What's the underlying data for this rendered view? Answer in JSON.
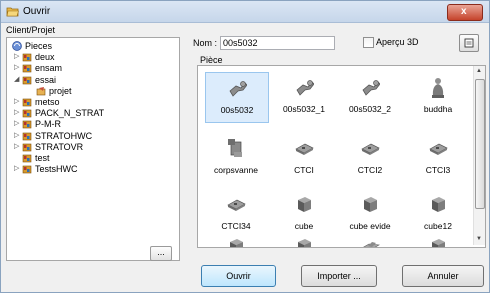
{
  "window": {
    "title": "Ouvrir",
    "close_label": "x"
  },
  "left_panel": {
    "label": "Client/Projet",
    "tree": [
      {
        "label": "Pieces",
        "icon": "pieces-icon",
        "expander": "",
        "level": 0
      },
      {
        "label": "deux",
        "icon": "folder-icon",
        "expander": "▷",
        "level": 1
      },
      {
        "label": "ensam",
        "icon": "folder-icon",
        "expander": "▷",
        "level": 1
      },
      {
        "label": "essai",
        "icon": "folder-icon",
        "expander": "◢",
        "level": 1
      },
      {
        "label": "projet",
        "icon": "project-icon",
        "expander": "",
        "level": 2
      },
      {
        "label": "metso",
        "icon": "folder-icon",
        "expander": "▷",
        "level": 1
      },
      {
        "label": "PACK_N_STRAT",
        "icon": "folder-icon",
        "expander": "▷",
        "level": 1
      },
      {
        "label": "P-M-R",
        "icon": "folder-icon",
        "expander": "▷",
        "level": 1
      },
      {
        "label": "STRATOHWC",
        "icon": "folder-icon",
        "expander": "▷",
        "level": 1
      },
      {
        "label": "STRATOVR",
        "icon": "folder-icon",
        "expander": "▷",
        "level": 1
      },
      {
        "label": "test",
        "icon": "folder-icon",
        "expander": "",
        "level": 1
      },
      {
        "label": "TestsHWC",
        "icon": "folder-icon",
        "expander": "▷",
        "level": 1
      }
    ],
    "browse_button": "..."
  },
  "right_panel": {
    "name_label": "Nom :",
    "name_value": "00s5032",
    "preview3d_label": "Aperçu 3D",
    "pieces_label": "Pièce",
    "items": [
      {
        "label": "00s5032",
        "icon": "valve-icon",
        "selected": true
      },
      {
        "label": "00s5032_1",
        "icon": "valve-icon",
        "selected": false
      },
      {
        "label": "00s5032_2",
        "icon": "valve-icon",
        "selected": false
      },
      {
        "label": "buddha",
        "icon": "statue-icon",
        "selected": false
      },
      {
        "label": "corpsvanne",
        "icon": "valve-body-icon",
        "selected": false
      },
      {
        "label": "CTCI",
        "icon": "plate-icon",
        "selected": false
      },
      {
        "label": "CTCI2",
        "icon": "plate-icon",
        "selected": false
      },
      {
        "label": "CTCI3",
        "icon": "plate-icon",
        "selected": false
      },
      {
        "label": "CTCI34",
        "icon": "plate-icon",
        "selected": false
      },
      {
        "label": "cube",
        "icon": "cube-icon",
        "selected": false
      },
      {
        "label": "cube evide",
        "icon": "cube-icon",
        "selected": false
      },
      {
        "label": "cube12",
        "icon": "cube-icon",
        "selected": false
      },
      {
        "label": "",
        "icon": "cube-icon",
        "selected": false
      },
      {
        "label": "",
        "icon": "cube-icon",
        "selected": false
      },
      {
        "label": "",
        "icon": "part-icon",
        "selected": false
      },
      {
        "label": "",
        "icon": "cube-icon",
        "selected": false
      }
    ]
  },
  "buttons": {
    "open": "Ouvrir",
    "import": "Importer ...",
    "cancel": "Annuler"
  },
  "colors": {
    "selection": "#dcecfc",
    "accent": "#3c7fb1",
    "folder": "#d89a2b"
  }
}
